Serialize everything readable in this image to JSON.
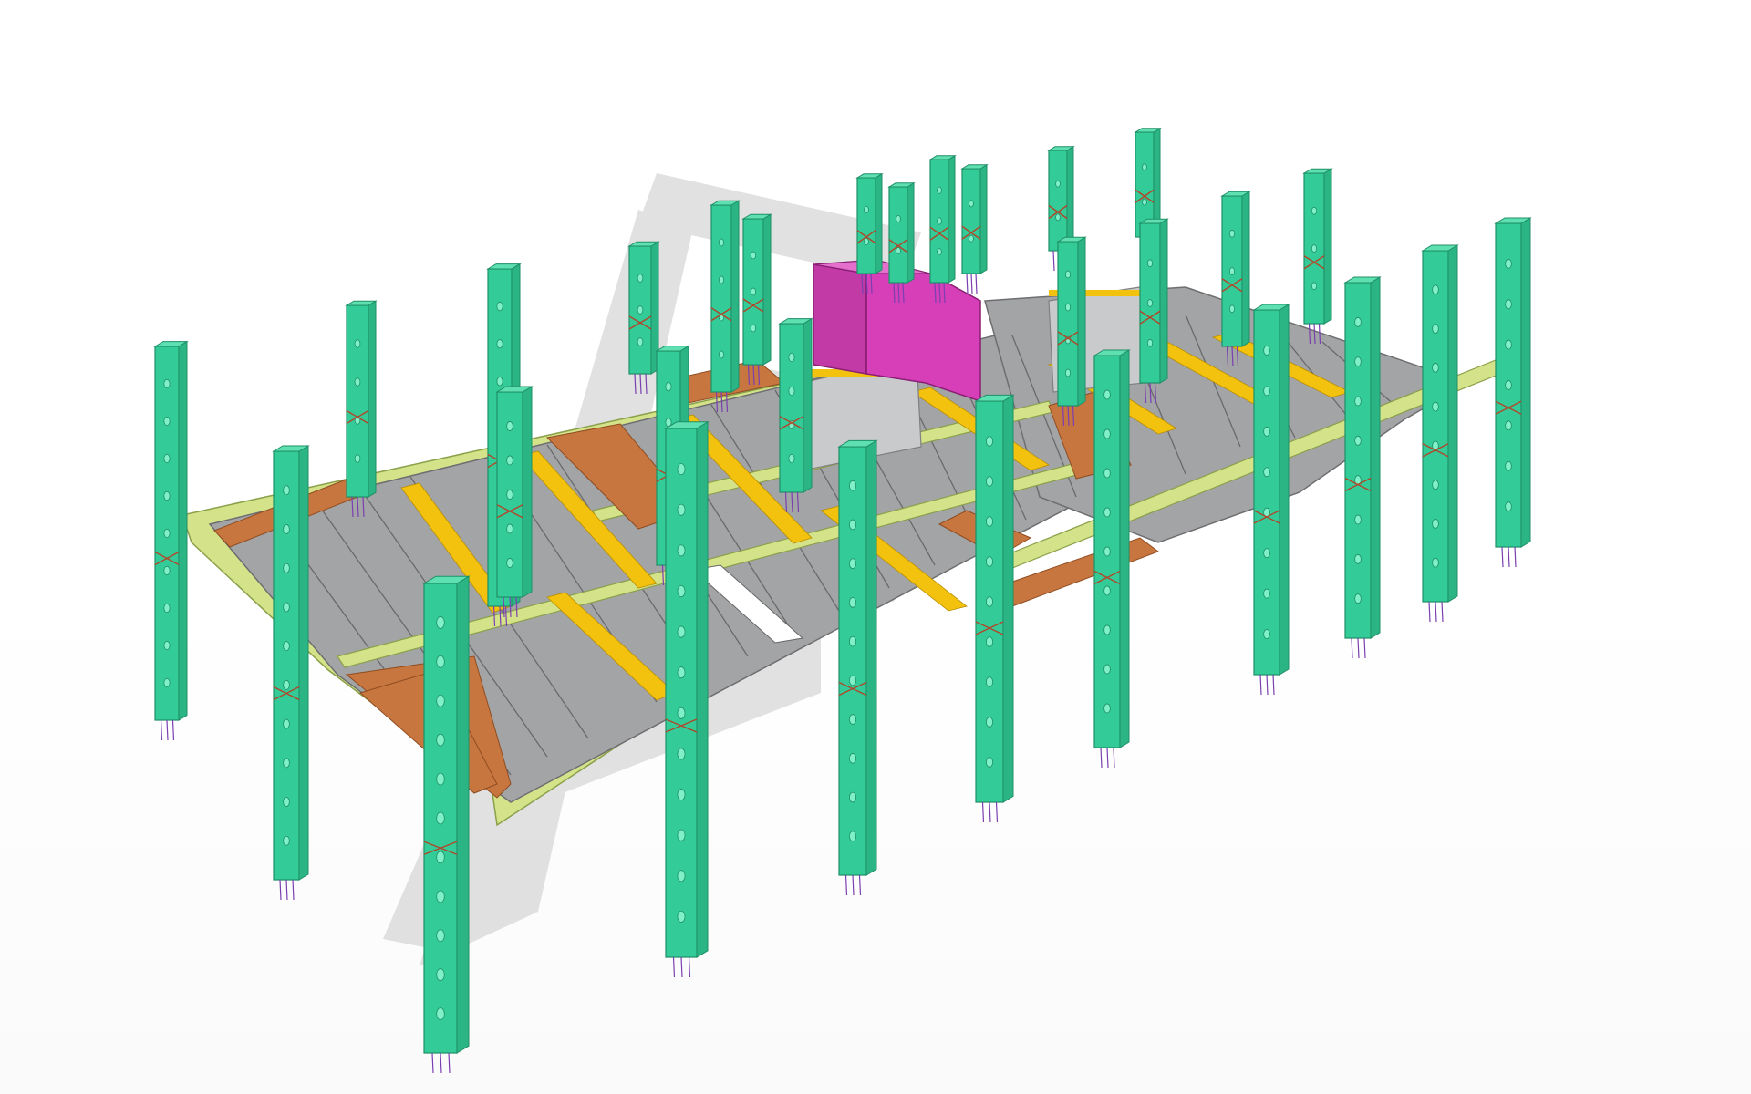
{
  "viewport": {
    "view": "3d-model",
    "background": "#ffffff"
  },
  "legend_colors": {
    "column": "#33cc99",
    "column_edge": "#1f8f66",
    "slab": "#9fa0a2",
    "slab_joint": "#6e6e70",
    "beam": "#d4e38a",
    "topping_band": "#c8763f",
    "strip": "#f2c20f",
    "core": "#d63fb8",
    "wall": "#c9cacc",
    "shadow": "#dcdcdc",
    "rebar": "#7a3fb0"
  }
}
